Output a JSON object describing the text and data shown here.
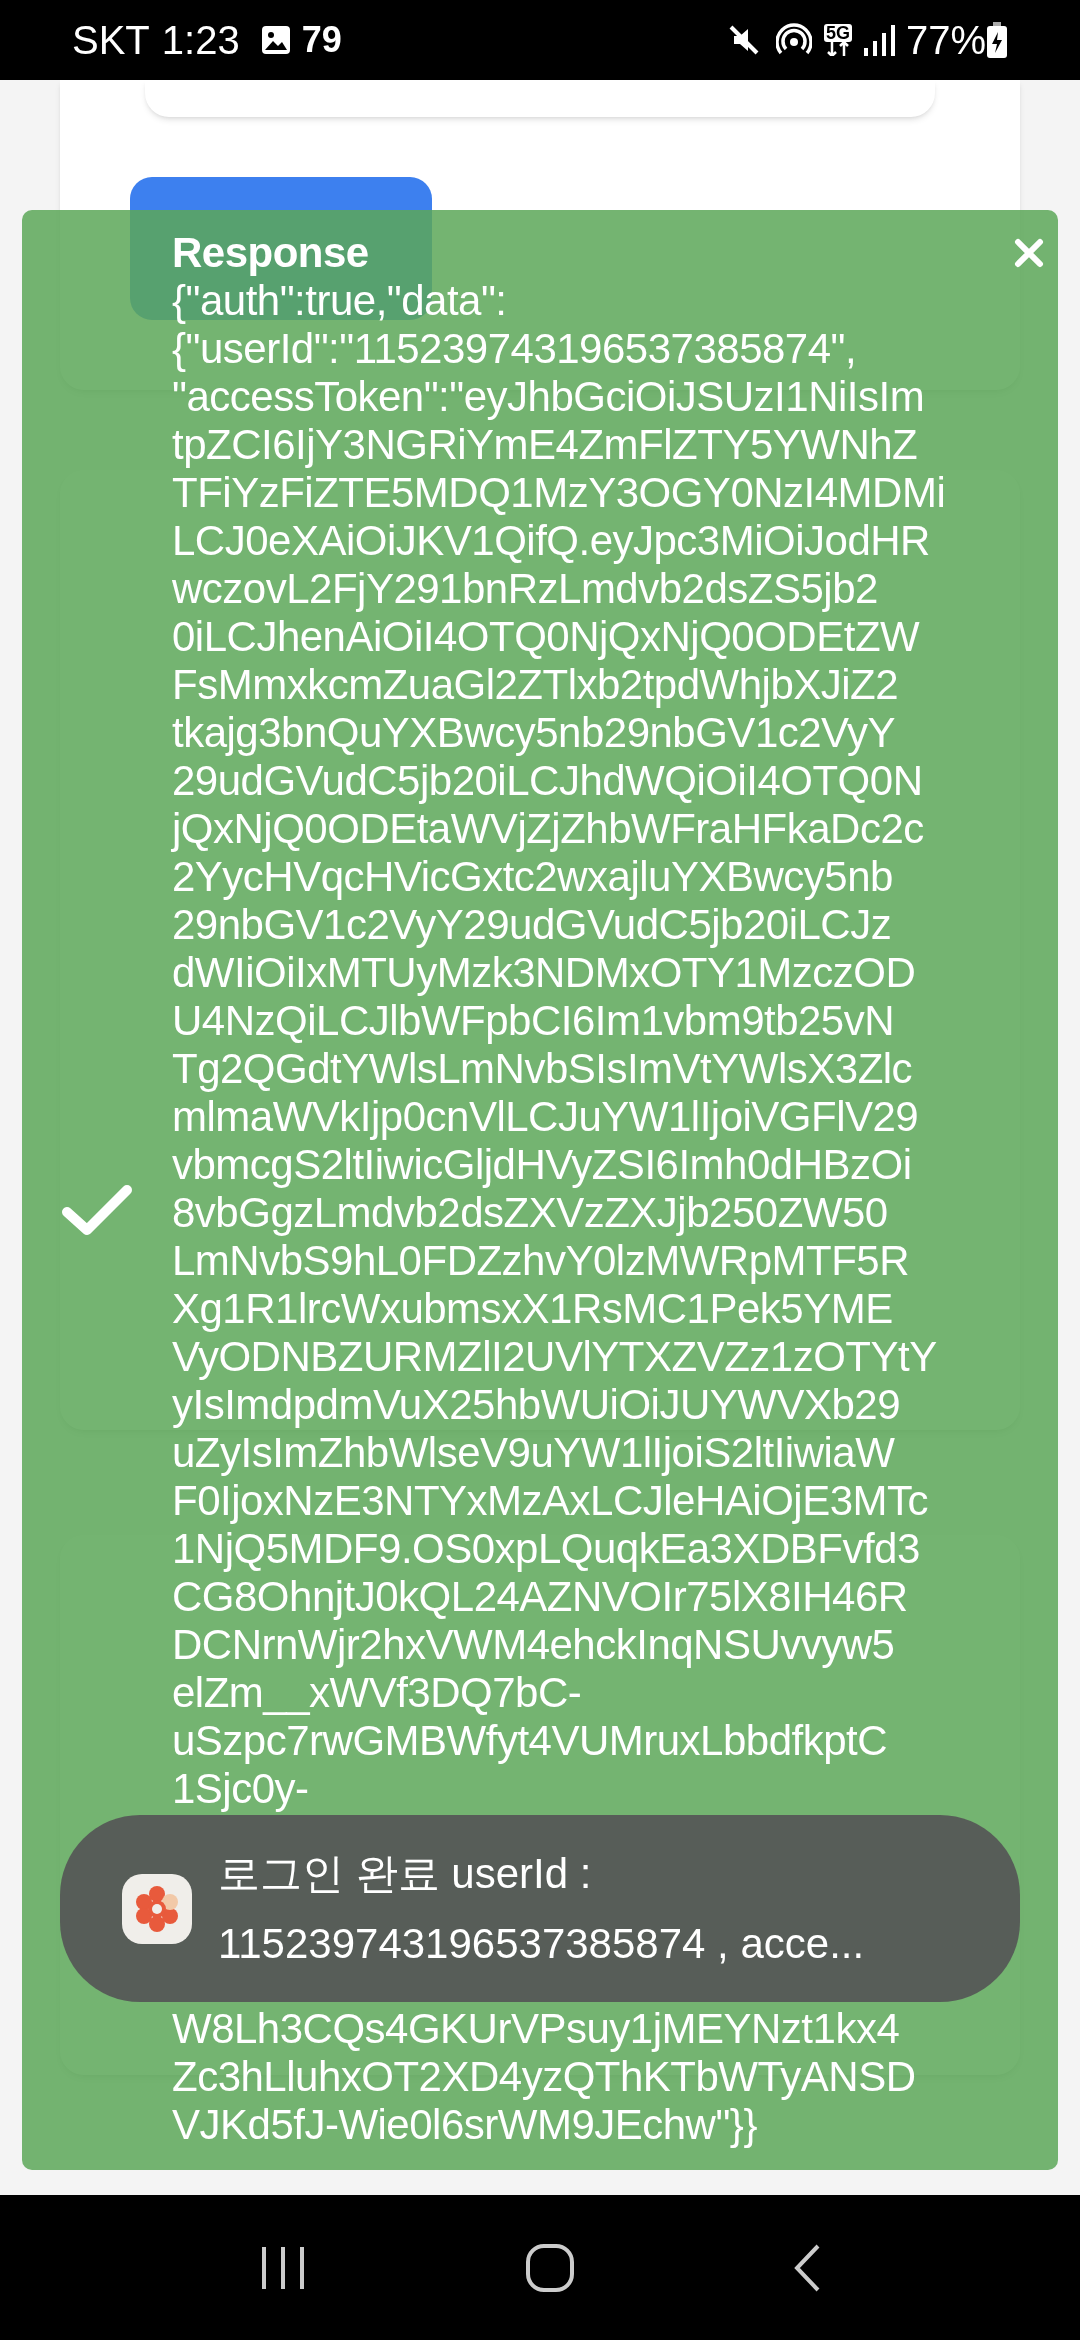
{
  "status_bar": {
    "carrier": "SKT",
    "time": "1:23",
    "notification_count": "79",
    "network": "5G",
    "battery": "77%"
  },
  "response_panel": {
    "title": "Response",
    "lines_above": [
      "{\"auth\":true,\"data\":",
      "{\"userId\":\"115239743196537385874\",",
      "\"accessToken\":\"eyJhbGciOiJSUzI1NiIsIm",
      "tpZCI6IjY3NGRiYmE4ZmFlZTY5YWNhZ",
      "TFiYzFiZTE5MDQ1MzY3OGY0NzI4MDMi",
      "LCJ0eXAiOiJKV1QifQ.eyJpc3MiOiJodHR",
      "wczovL2FjY291bnRzLmdvb2dsZS5jb2",
      "0iLCJhenAiOiI4OTQ0NjQxNjQ0ODEtZW",
      "FsMmxkcmZuaGl2ZTlxb2tpdWhjbXJiZ2",
      "tkajg3bnQuYXBwcy5nb29nbGV1c2VyY",
      "29udGVudC5jb20iLCJhdWQiOiI4OTQ0N",
      "jQxNjQ0ODEtaWVjZjZhbWFraHFkaDc2c",
      "2YycHVqcHVicGxtc2wxajluYXBwcy5nb",
      "29nbGV1c2VyY29udGVudC5jb20iLCJz",
      "dWIiOiIxMTUyMzk3NDMxOTY1MzczOD",
      "U4NzQiLCJlbWFpbCI6Im1vbm9tb25vN",
      "Tg2QGdtYWlsLmNvbSIsImVtYWlsX3Zlc",
      "mlmaWVkIjp0cnVlLCJuYW1lIjoiVGFlV29",
      "vbmcgS2ltIiwicGljdHVyZSI6Imh0dHBzOi",
      "8vbGgzLmdvb2dsZXVzZXJjb250ZW50",
      "LmNvbS9hL0FDZzhvY0lzMWRpMTF5R",
      "Xg1R1lrcWxubmsxX1RsMC1Pek5YME",
      "VyODNBZURMZlI2UVlYTXZVZz1zOTYtY",
      "yIsImdpdmVuX25hbWUiOiJUYWVXb29",
      "uZyIsImZhbWlseV9uYW1lIjoiS2ltIiwiaW",
      "F0IjoxNzE3NTYxMzAxLCJleHAiOjE3MTc",
      "1NjQ5MDF9.OS0xpLQuqkEa3XDBFvfd3",
      "CG8OhnjtJ0kQL24AZNVOIr75lX8IH46R",
      "DCNrnWjr2hxVWM4ehckInqNSUvvyw5",
      "elZm__xWVf3DQ7bC-",
      "uSzpc7rwGMBWfyt4VUMruxLbbdfkptC",
      "1Sjc0y-"
    ],
    "lines_below": [
      "W8Lh3CQs4GKUrVPsuy1jMEYNzt1kx4",
      "Zc3hLluhxOT2XD4yzQThKTbWTyANSD",
      "VJKd5fJ-Wie0l6srWM9JEchw\"}}"
    ]
  },
  "toast": {
    "lines": [
      "로그인 완료 userId :",
      "115239743196537385874 , acce..."
    ]
  }
}
